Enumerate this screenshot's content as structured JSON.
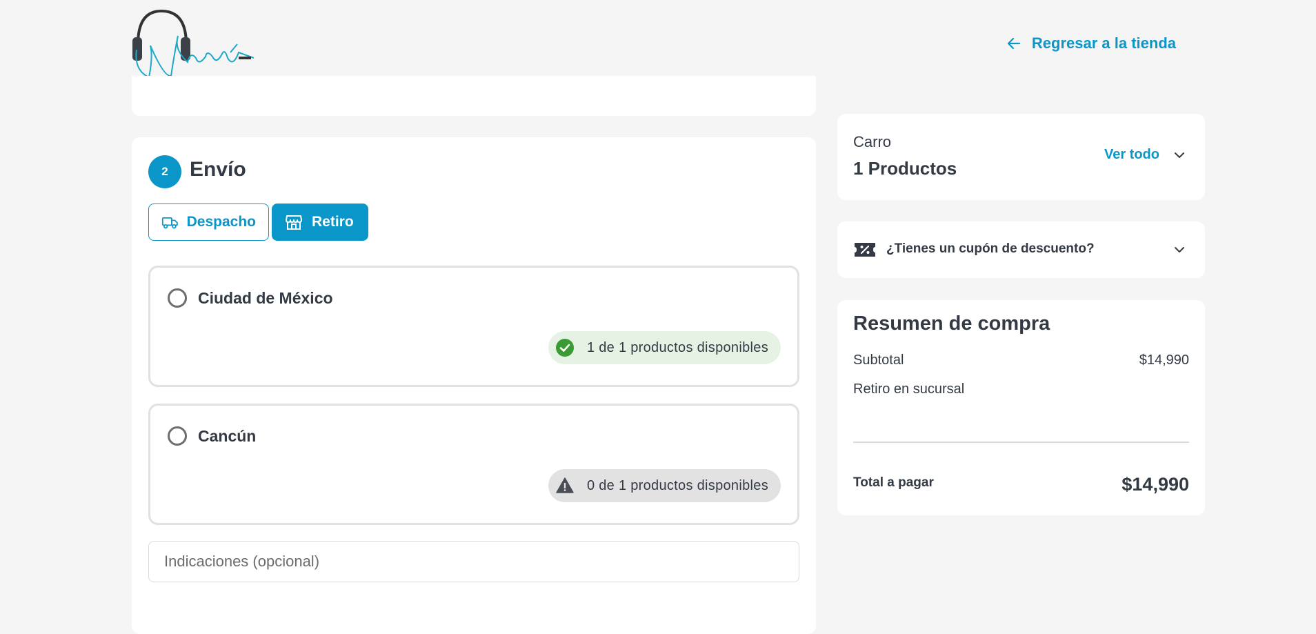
{
  "header": {
    "back_link": "Regresar a la tienda",
    "logo_icon": "headphones-logo-icon"
  },
  "shipping": {
    "step_number": "2",
    "title": "Envío",
    "tabs": [
      {
        "label": "Despacho",
        "icon": "truck-icon",
        "active": false
      },
      {
        "label": "Retiro",
        "icon": "store-icon",
        "active": true
      }
    ],
    "stores": [
      {
        "name": "Ciudad de México",
        "availability": "1 de 1 productos disponibles",
        "status": "available",
        "selected": false
      },
      {
        "name": "Cancún",
        "availability": "0 de 1 productos disponibles",
        "status": "unavailable",
        "selected": false
      }
    ],
    "indications_placeholder": "Indicaciones (opcional)",
    "indications_value": ""
  },
  "cart": {
    "label": "Carro",
    "count": "1 Productos",
    "view_all": "Ver todo"
  },
  "coupon": {
    "label": "¿Tienes un cupón de descuento?"
  },
  "summary": {
    "title": "Resumen de compra",
    "subtotal_label": "Subtotal",
    "subtotal_value": "$14,990",
    "pickup_label": "Retiro en sucursal",
    "total_label": "Total a pagar",
    "total_value": "$14,990"
  },
  "colors": {
    "accent": "#0a96c9",
    "success": "#3a9b35",
    "warning_icon": "#4a4f57",
    "background": "#f5f5f5"
  }
}
